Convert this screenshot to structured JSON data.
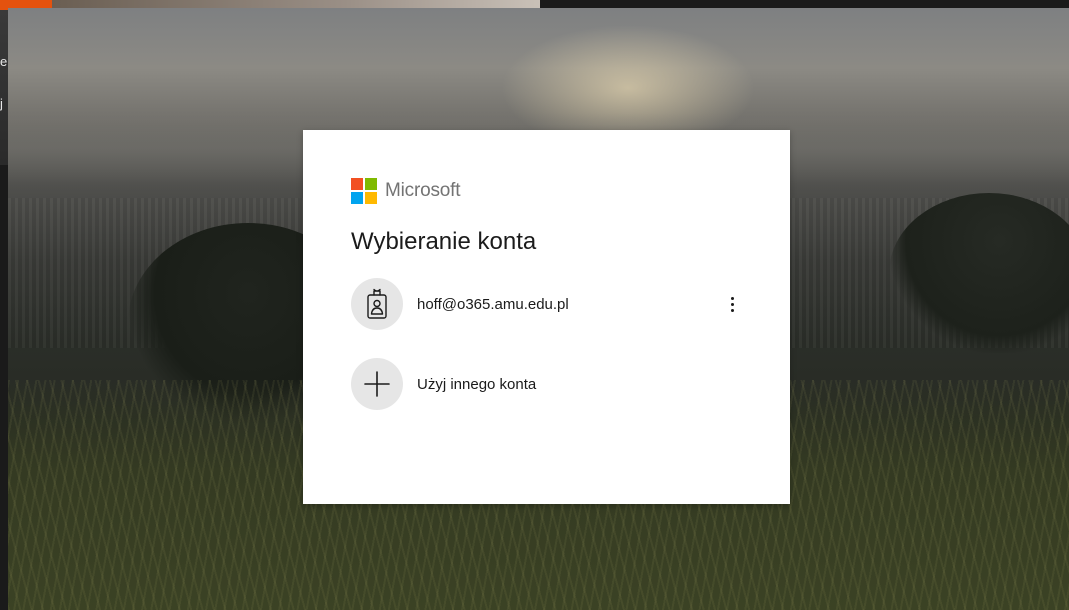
{
  "background_page": {
    "accent_color": "#e4520e",
    "edge_glyphs": [
      "e",
      "j"
    ]
  },
  "dialog": {
    "brand": {
      "name": "Microsoft",
      "logo_colors": [
        "#f25022",
        "#7fba00",
        "#00a4ef",
        "#ffb900"
      ]
    },
    "title": "Wybieranie konta",
    "accounts": [
      {
        "email": "hoff@o365.amu.edu.pl",
        "icon": "work-badge-icon",
        "menu_icon": "more-options-icon"
      }
    ],
    "other_account": {
      "label": "Użyj innego konta",
      "icon": "plus-icon"
    }
  }
}
